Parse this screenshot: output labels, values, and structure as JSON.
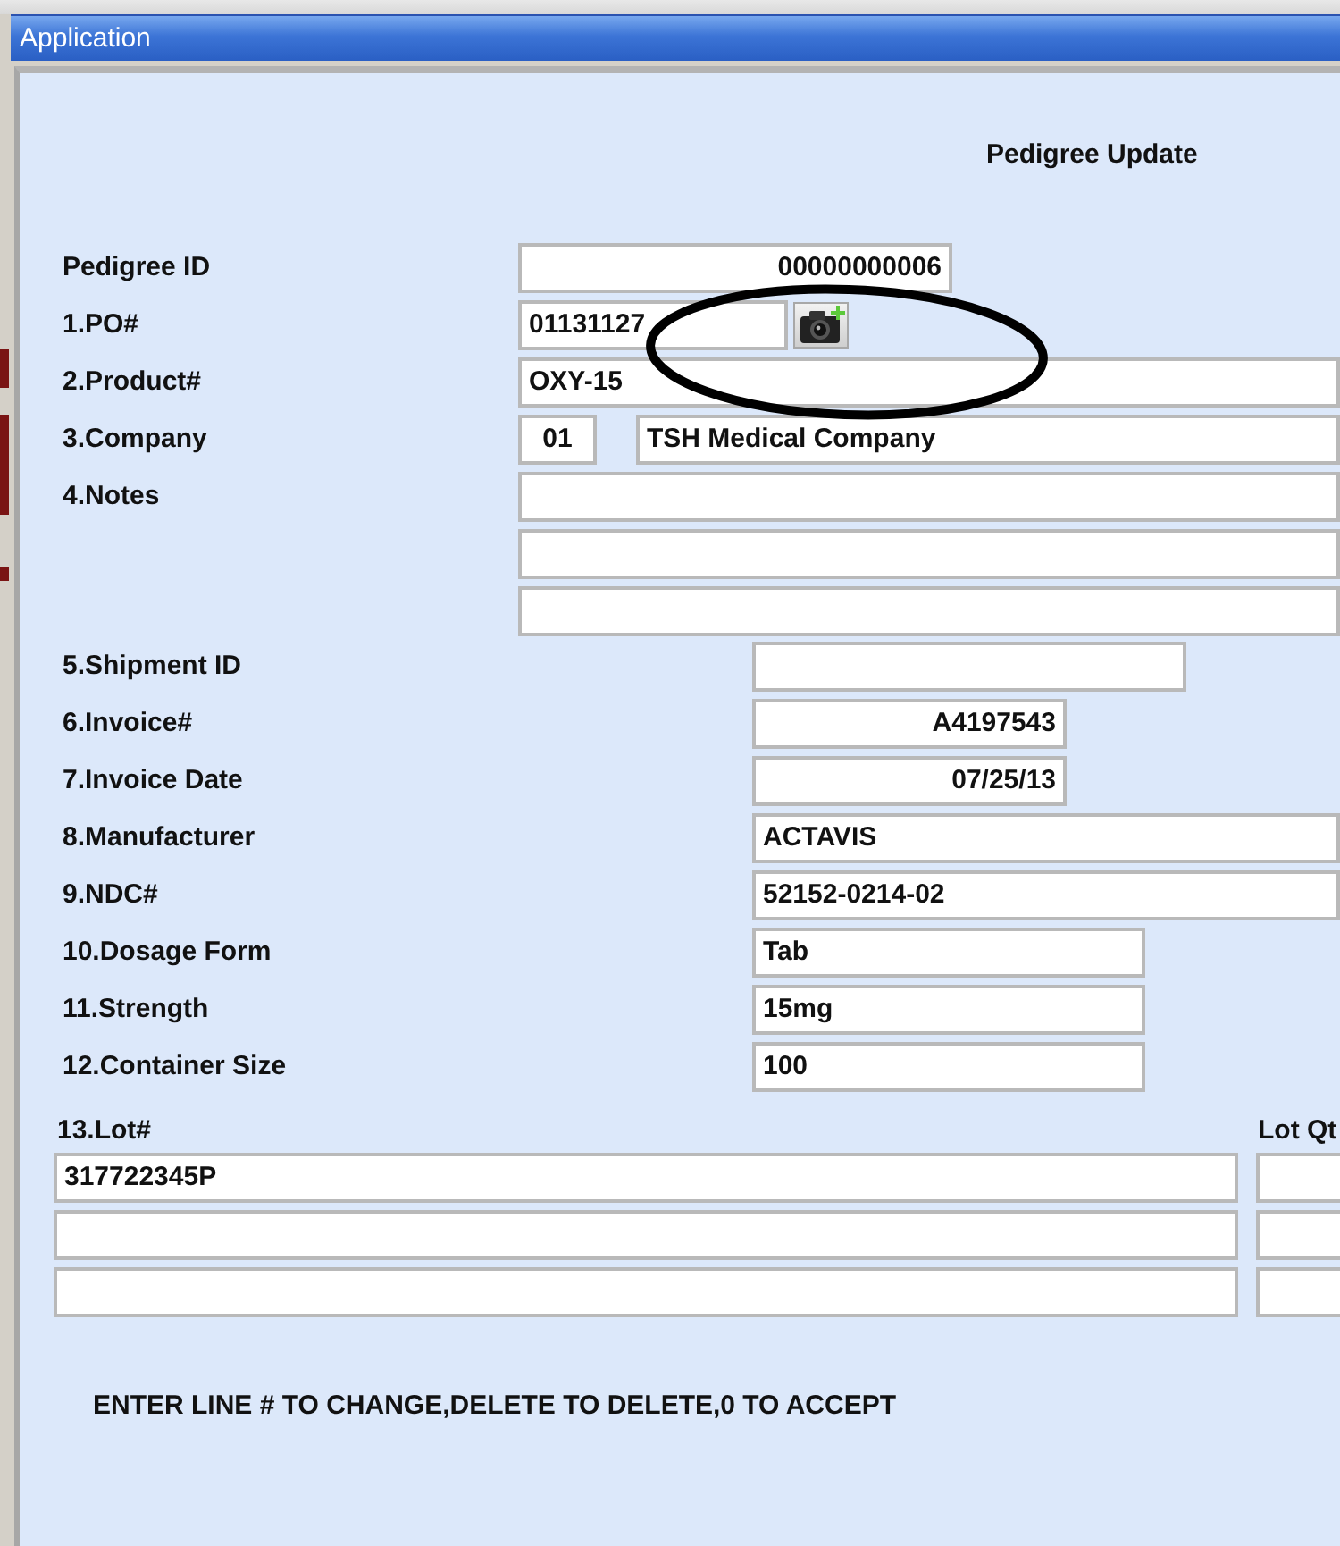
{
  "window": {
    "title": "Application"
  },
  "heading": "Pedigree Update",
  "upper_fields": [
    {
      "label": "Pedigree ID",
      "lines": [
        [
          {
            "kind": "id",
            "value": "00000000006"
          }
        ]
      ]
    },
    {
      "label": "1.PO#",
      "lines": [
        [
          {
            "kind": "po",
            "value": "01131127"
          },
          {
            "kind": "camera"
          }
        ]
      ]
    },
    {
      "label": "2.Product#",
      "lines": [
        [
          {
            "kind": "wide",
            "value": "OXY-15"
          }
        ]
      ]
    },
    {
      "label": "3.Company",
      "lines": [
        [
          {
            "kind": "code",
            "value": "01"
          },
          {
            "kind": "name",
            "value": "TSH Medical Company"
          }
        ]
      ]
    },
    {
      "label": "4.Notes",
      "lines": [
        [
          {
            "kind": "wide"
          }
        ],
        [
          {
            "kind": "wide"
          }
        ],
        [
          {
            "kind": "wide"
          }
        ]
      ]
    }
  ],
  "lower_fields": [
    {
      "label": "5.Shipment ID",
      "lines": [
        [
          {
            "kind": "ship"
          }
        ]
      ]
    },
    {
      "label": "6.Invoice#",
      "lines": [
        [
          {
            "kind": "number",
            "value": "A4197543"
          }
        ]
      ]
    },
    {
      "label": "7.Invoice Date",
      "lines": [
        [
          {
            "kind": "number",
            "value": "07/25/13"
          }
        ]
      ]
    },
    {
      "label": "8.Manufacturer",
      "lines": [
        [
          {
            "kind": "wide",
            "value": "ACTAVIS"
          }
        ]
      ]
    },
    {
      "label": "9.NDC#",
      "lines": [
        [
          {
            "kind": "wide",
            "value": "52152-0214-02"
          }
        ]
      ]
    },
    {
      "label": "10.Dosage Form",
      "lines": [
        [
          {
            "kind": "text",
            "value": "Tab"
          }
        ]
      ]
    },
    {
      "label": "11.Strength",
      "lines": [
        [
          {
            "kind": "text",
            "value": "15mg"
          }
        ]
      ]
    },
    {
      "label": "12.Container Size",
      "lines": [
        [
          {
            "kind": "text",
            "value": "100"
          }
        ]
      ]
    }
  ],
  "lots": {
    "lot_label": "13.Lot#",
    "qty_label": "Lot Qt",
    "rows": [
      {
        "lot": "317722345P"
      },
      {},
      {}
    ]
  },
  "footer": "ENTER LINE # TO CHANGE,DELETE TO DELETE,0 TO ACCEPT",
  "annotation": {
    "kind": "ellipse"
  }
}
